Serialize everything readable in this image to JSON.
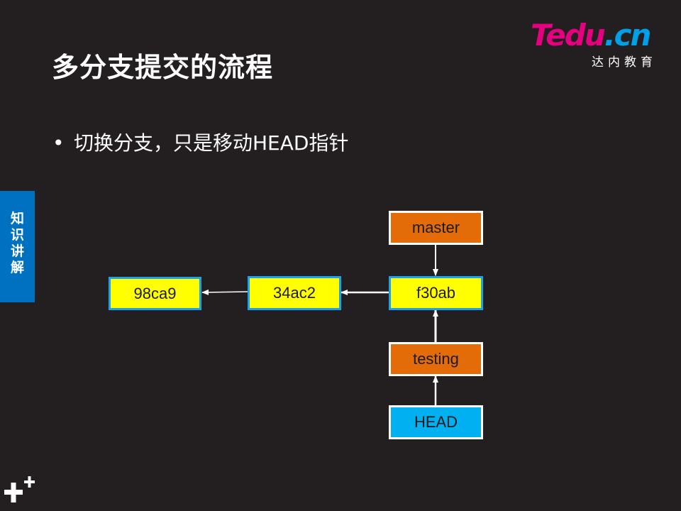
{
  "slide": {
    "title": "多分支提交的流程",
    "bullet_symbol": "•",
    "bullet_text": "切换分支，只是移动HEAD指针",
    "side_tab": "知识讲解"
  },
  "logo": {
    "brand_part1": "Te",
    "brand_part2": "du",
    "brand_part3": ".cn",
    "subtitle": "达内教育"
  },
  "diagram": {
    "commits": [
      "98ca9",
      "34ac2",
      "f30ab"
    ],
    "branches": [
      "master",
      "testing"
    ],
    "head": "HEAD"
  },
  "colors": {
    "background": "#231f20",
    "commit_fill": "#ffff00",
    "commit_border": "#1aa3e8",
    "branch_fill": "#e36c09",
    "head_fill": "#00b0f0",
    "side_tab": "#0070c0",
    "logo_pink": "#e4007f",
    "logo_blue": "#00a0e9"
  }
}
